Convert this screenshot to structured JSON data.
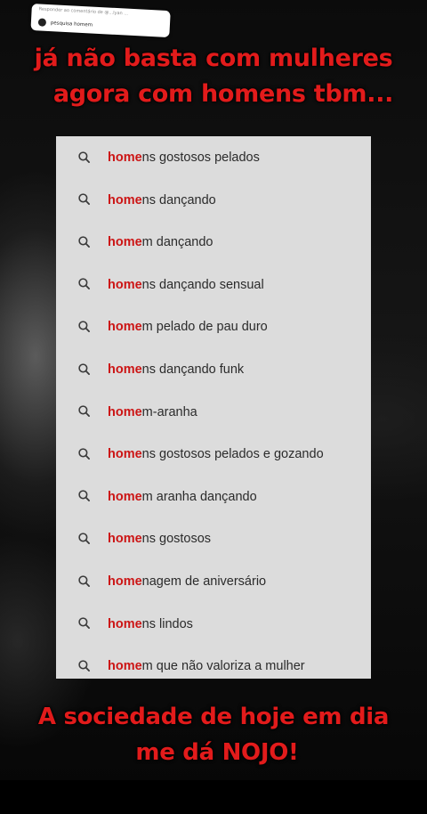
{
  "reply_sticker": {
    "header": "Responder ao comentário de @...lyan ...",
    "comment": "pesquisa homem"
  },
  "caption_top": {
    "line1": "já não basta com mulheres",
    "line2": "agora com homens tbm..."
  },
  "suggestions": {
    "icon": "search-icon",
    "highlight_color": "#cc1515",
    "items": [
      {
        "match": "home",
        "rest": "ns gostosos pelados"
      },
      {
        "match": "home",
        "rest": "ns dançando"
      },
      {
        "match": "home",
        "rest": "m dançando"
      },
      {
        "match": "home",
        "rest": "ns dançando sensual"
      },
      {
        "match": "home",
        "rest": "m pelado de pau duro"
      },
      {
        "match": "home",
        "rest": "ns dançando funk"
      },
      {
        "match": "home",
        "rest": "m-aranha"
      },
      {
        "match": "home",
        "rest": "ns gostosos pelados e gozando"
      },
      {
        "match": "home",
        "rest": "m aranha dançando"
      },
      {
        "match": "home",
        "rest": "ns gostosos"
      },
      {
        "match": "home",
        "rest": "nagem de aniversário"
      },
      {
        "match": "home",
        "rest": "ns lindos"
      },
      {
        "match": "home",
        "rest": "m que não valoriza a mulher"
      }
    ]
  },
  "caption_bottom": {
    "line1": "A sociedade de hoje em dia",
    "line2": "me dá NOJO!"
  },
  "colors": {
    "caption": "#e21b1b",
    "panel_background": "#dcdcdc"
  }
}
